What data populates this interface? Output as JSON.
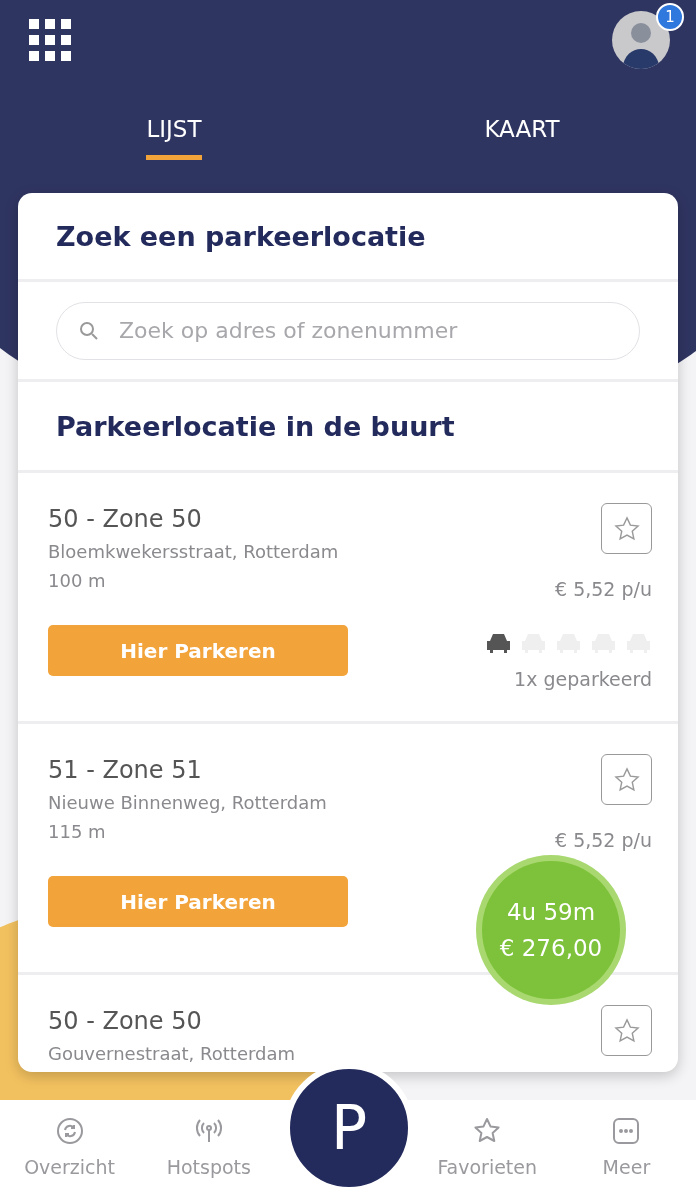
{
  "header": {
    "notification_count": "1"
  },
  "tabs": [
    {
      "label": "LIJST",
      "selected": true
    },
    {
      "label": "KAART",
      "selected": false
    }
  ],
  "card": {
    "title": "Zoek een parkeerlocatie",
    "search": {
      "placeholder": "Zoek op adres of zonenummer"
    },
    "section_title": "Parkeerlocatie in de buurt"
  },
  "locations": [
    {
      "name": "50 - Zone 50",
      "address": "Bloemkwekersstraat, Rotterdam",
      "distance": "100 m",
      "price": "€ 5,52 p/u",
      "favorite": false,
      "button": "Hier Parkeren",
      "cars": [
        {
          "parked": true
        },
        {
          "parked": false
        },
        {
          "parked": false
        },
        {
          "parked": false
        },
        {
          "parked": false
        }
      ],
      "parked_text": "1x geparkeerd"
    },
    {
      "name": "51 - Zone 51",
      "address": "Nieuwe Binnenweg, Rotterdam",
      "distance": "115 m",
      "price": "€ 5,52 p/u",
      "favorite": false,
      "button": "Hier Parkeren"
    },
    {
      "name": "50 - Zone 50",
      "address": "Gouvernestraat, Rotterdam",
      "favorite": false
    }
  ],
  "active_session": {
    "duration": "4u 59m",
    "cost": "€ 276,00"
  },
  "nav": [
    {
      "label": "Overzicht",
      "kind": "sync"
    },
    {
      "label": "Hotspots",
      "kind": "antenna"
    },
    {
      "label": "P",
      "kind": "park"
    },
    {
      "label": "Favorieten",
      "kind": "star"
    },
    {
      "label": "Meer",
      "kind": "more"
    }
  ]
}
